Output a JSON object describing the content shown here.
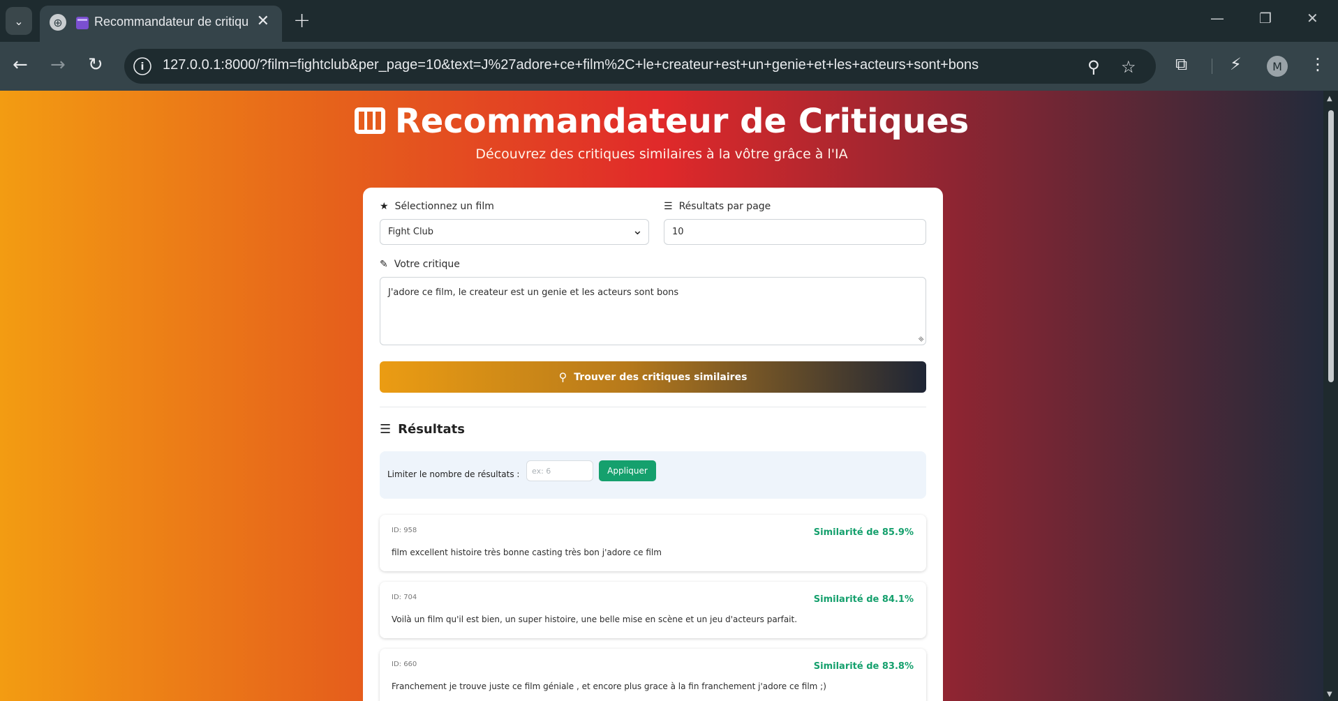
{
  "browser": {
    "tab_title": "Recommandateur de critiqu",
    "url": "127.0.0.1:8000/?film=fightclub&per_page=10&text=J%27adore+ce+film%2C+le+createur+est+un+genie+et+les+acteurs+sont+bons",
    "profile_initial": "M",
    "icons": [
      "tab-list-icon",
      "globe-icon",
      "close-icon",
      "new-tab-icon",
      "minimize-icon",
      "restore-icon",
      "window-close-icon",
      "back-icon",
      "forward-icon",
      "reload-icon",
      "site-info-icon",
      "zoom-icon",
      "bookmark-star-icon",
      "extensions-icon",
      "performance-icon",
      "menu-icon"
    ]
  },
  "page": {
    "title": "Recommandateur de Critiques",
    "subtitle": "Découvrez des critiques similaires à la vôtre grâce à l'IA"
  },
  "form": {
    "film_label": "Sélectionnez un film",
    "film_value": "Fight Club",
    "per_page_label": "Résultats par page",
    "per_page_value": "10",
    "review_label": "Votre critique",
    "review_value": "J'adore ce film, le createur est un genie et les acteurs sont bons",
    "submit_label": "Trouver des critiques similaires"
  },
  "results": {
    "title": "Résultats",
    "limit_label": "Limiter le nombre de résultats :",
    "limit_placeholder": "ex: 6",
    "apply_label": "Appliquer",
    "items": [
      {
        "id": "ID: 958",
        "similarity": "Similarité de 85.9%",
        "text": "film excellent histoire très bonne casting très bon j'adore ce film"
      },
      {
        "id": "ID: 704",
        "similarity": "Similarité de 84.1%",
        "text": "Voilà un film qu'il est bien, un super histoire, une belle mise en scène et un jeu d'acteurs parfait."
      },
      {
        "id": "ID: 660",
        "similarity": "Similarité de 83.8%",
        "text": "Franchement je trouve juste ce film géniale , et encore plus grace à la fin franchement j'adore ce film ;)"
      }
    ]
  },
  "colors": {
    "accent_green": "#15a06d",
    "gradient_start": "#f39c12",
    "gradient_mid": "#e0292a",
    "gradient_end": "#232a3a"
  }
}
